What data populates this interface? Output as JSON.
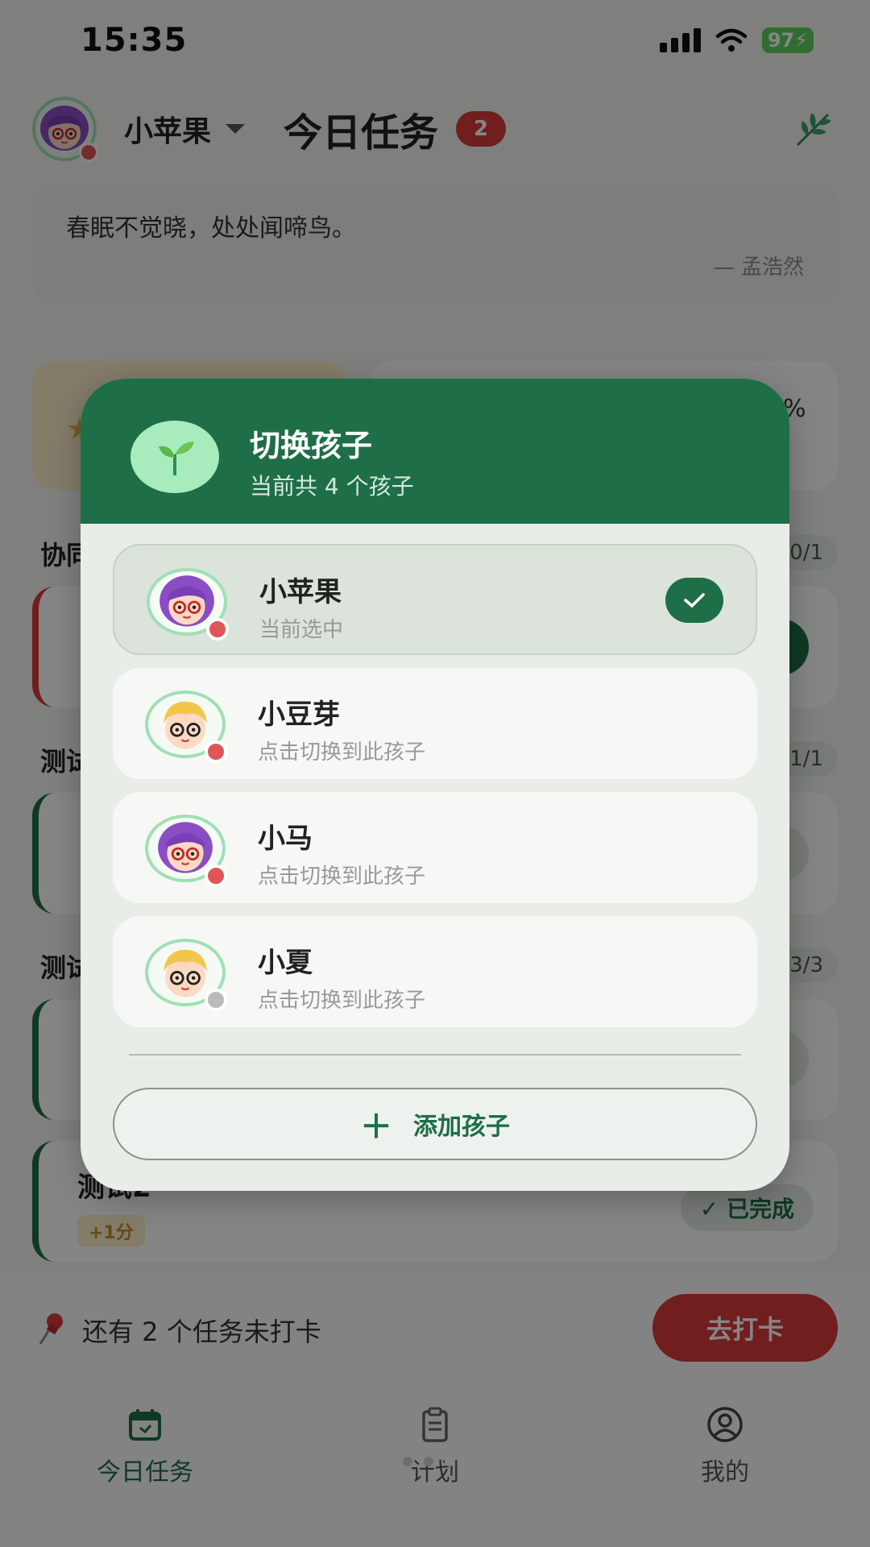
{
  "status_bar": {
    "time": "15:35",
    "battery": "97"
  },
  "header": {
    "child_name": "小苹果",
    "title": "今日任务",
    "badge_count": "2"
  },
  "poem": {
    "text": "春眠不觉晓，处处闻啼鸟。",
    "author": "— 孟浩然"
  },
  "background": {
    "sections": [
      {
        "title": "协同",
        "count": "0/1"
      },
      {
        "title": "测试",
        "count": "1/1"
      },
      {
        "title": "测试",
        "count": "3/3"
      }
    ],
    "task": {
      "name": "测试2",
      "points": "+1分",
      "status": "✓ 已完成"
    },
    "stat_percent": "%"
  },
  "reminder": {
    "text": "还有 2 个任务未打卡",
    "button": "去打卡"
  },
  "nav": {
    "items": [
      {
        "label": "今日任务",
        "icon": "calendar-icon"
      },
      {
        "label": "计划",
        "icon": "clipboard-icon"
      },
      {
        "label": "我的",
        "icon": "profile-icon"
      }
    ]
  },
  "modal": {
    "title": "切换孩子",
    "subtitle": "当前共 4 个孩子",
    "children": [
      {
        "name": "小苹果",
        "subtitle": "当前选中",
        "selected": true,
        "dot_color": "#e05555",
        "avatar": "girl-avatar"
      },
      {
        "name": "小豆芽",
        "subtitle": "点击切换到此孩子",
        "selected": false,
        "dot_color": "#e05555",
        "avatar": "boy-avatar"
      },
      {
        "name": "小马",
        "subtitle": "点击切换到此孩子",
        "selected": false,
        "dot_color": "#e05555",
        "avatar": "girl-avatar"
      },
      {
        "name": "小夏",
        "subtitle": "点击切换到此孩子",
        "selected": false,
        "dot_color": "#bbbbbb",
        "avatar": "boy-avatar"
      }
    ],
    "add_button": "添加孩子"
  },
  "colors": {
    "primary": "#1e6e47",
    "accent_red": "#d63b3b",
    "avatar_ring": "#9fe0b5"
  }
}
